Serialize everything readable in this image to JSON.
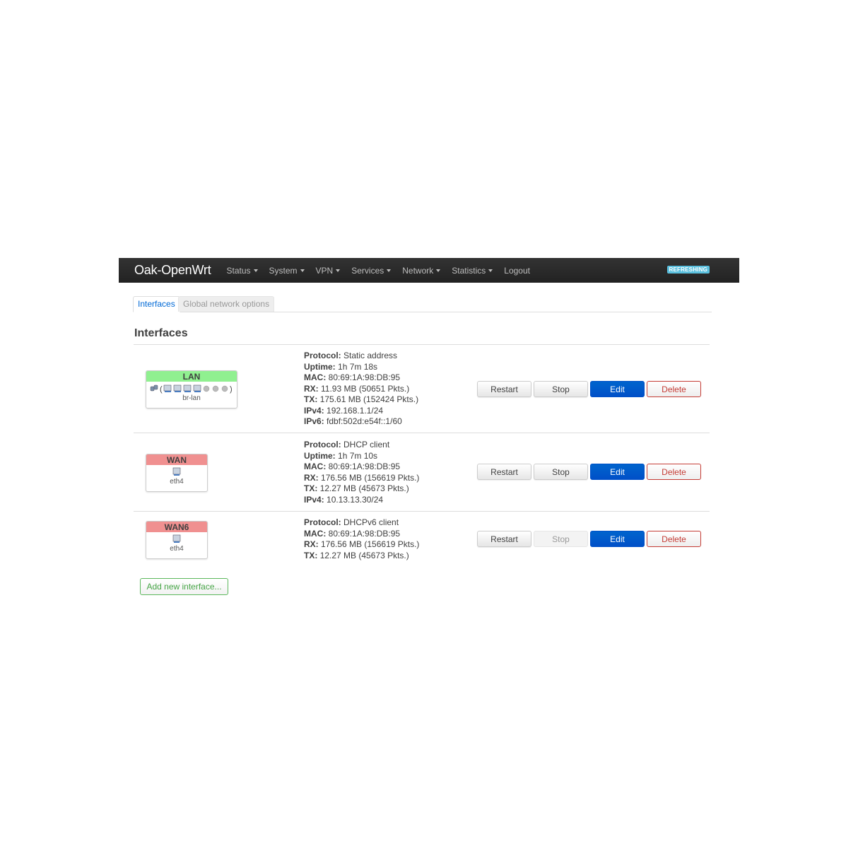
{
  "app": {
    "brand": "Oak-OpenWrt"
  },
  "nav": {
    "items": [
      {
        "label": "Status",
        "has_dropdown": true
      },
      {
        "label": "System",
        "has_dropdown": true
      },
      {
        "label": "VPN",
        "has_dropdown": true
      },
      {
        "label": "Services",
        "has_dropdown": true
      },
      {
        "label": "Network",
        "has_dropdown": true
      },
      {
        "label": "Statistics",
        "has_dropdown": true
      },
      {
        "label": "Logout",
        "has_dropdown": false
      }
    ],
    "refresh_badge": "REFRESHING"
  },
  "tabs": [
    {
      "label": "Interfaces",
      "active": true
    },
    {
      "label": "Global network options",
      "active": false
    }
  ],
  "section_title": "Interfaces",
  "interfaces": [
    {
      "name": "LAN",
      "status_color": "#90f090",
      "device": "br-lan",
      "icon_summary": "bridge-with-ports-icon",
      "details": [
        {
          "label": "Protocol:",
          "value": "Static address"
        },
        {
          "label": "Uptime:",
          "value": "1h 7m 18s"
        },
        {
          "label": "MAC:",
          "value": "80:69:1A:98:DB:95"
        },
        {
          "label": "RX:",
          "value": "11.93 MB (50651 Pkts.)"
        },
        {
          "label": "TX:",
          "value": "175.61 MB (152424 Pkts.)"
        },
        {
          "label": "IPv4:",
          "value": "192.168.1.1/24"
        },
        {
          "label": "IPv6:",
          "value": "fdbf:502d:e54f::1/60"
        }
      ],
      "buttons": {
        "restart": "Restart",
        "stop": "Stop",
        "edit": "Edit",
        "delete": "Delete",
        "stop_disabled": false
      }
    },
    {
      "name": "WAN",
      "status_color": "#f09090",
      "device": "eth4",
      "icon_summary": "ethernet-port-icon",
      "details": [
        {
          "label": "Protocol:",
          "value": "DHCP client"
        },
        {
          "label": "Uptime:",
          "value": "1h 7m 10s"
        },
        {
          "label": "MAC:",
          "value": "80:69:1A:98:DB:95"
        },
        {
          "label": "RX:",
          "value": "176.56 MB (156619 Pkts.)"
        },
        {
          "label": "TX:",
          "value": "12.27 MB (45673 Pkts.)"
        },
        {
          "label": "IPv4:",
          "value": "10.13.13.30/24"
        }
      ],
      "buttons": {
        "restart": "Restart",
        "stop": "Stop",
        "edit": "Edit",
        "delete": "Delete",
        "stop_disabled": false
      }
    },
    {
      "name": "WAN6",
      "status_color": "#f09090",
      "device": "eth4",
      "icon_summary": "ethernet-port-icon",
      "details": [
        {
          "label": "Protocol:",
          "value": "DHCPv6 client"
        },
        {
          "label": "MAC:",
          "value": "80:69:1A:98:DB:95"
        },
        {
          "label": "RX:",
          "value": "176.56 MB (156619 Pkts.)"
        },
        {
          "label": "TX:",
          "value": "12.27 MB (45673 Pkts.)"
        }
      ],
      "buttons": {
        "restart": "Restart",
        "stop": "Stop",
        "edit": "Edit",
        "delete": "Delete",
        "stop_disabled": true
      }
    }
  ],
  "add_button": "Add new interface..."
}
